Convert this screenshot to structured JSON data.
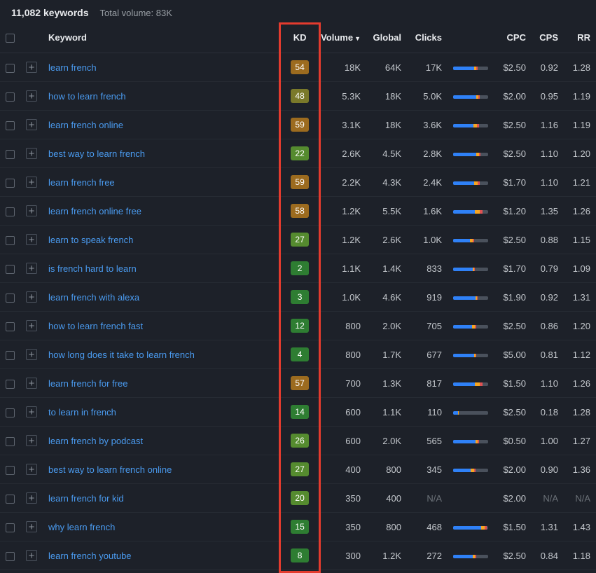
{
  "summary": {
    "keywords_count": "11,082 keywords",
    "total_volume": "Total volume: 83K"
  },
  "headers": {
    "keyword": "Keyword",
    "kd": "KD",
    "volume": "Volume",
    "global": "Global",
    "clicks": "Clicks",
    "cpc": "CPC",
    "cps": "CPS",
    "rr": "RR"
  },
  "rows": [
    {
      "keyword": "learn french",
      "kd": 54,
      "kd_cls": "amber",
      "volume": "18K",
      "global": "64K",
      "clicks": "17K",
      "bar": {
        "blue": 60,
        "orange": 6,
        "red": 4
      },
      "cpc": "$2.50",
      "cps": "0.92",
      "rr": "1.28"
    },
    {
      "keyword": "how to learn french",
      "kd": 48,
      "kd_cls": "olive",
      "volume": "5.3K",
      "global": "18K",
      "clicks": "5.0K",
      "bar": {
        "blue": 66,
        "orange": 6,
        "red": 4
      },
      "cpc": "$2.00",
      "cps": "0.95",
      "rr": "1.19"
    },
    {
      "keyword": "learn french online",
      "kd": 59,
      "kd_cls": "amber",
      "volume": "3.1K",
      "global": "18K",
      "clicks": "3.6K",
      "bar": {
        "blue": 58,
        "orange": 10,
        "red": 6
      },
      "cpc": "$2.50",
      "cps": "1.16",
      "rr": "1.19"
    },
    {
      "keyword": "best way to learn french",
      "kd": 22,
      "kd_cls": "lime",
      "volume": "2.6K",
      "global": "4.5K",
      "clicks": "2.8K",
      "bar": {
        "blue": 66,
        "orange": 8,
        "red": 4
      },
      "cpc": "$2.50",
      "cps": "1.10",
      "rr": "1.20"
    },
    {
      "keyword": "learn french free",
      "kd": 59,
      "kd_cls": "amber",
      "volume": "2.2K",
      "global": "4.3K",
      "clicks": "2.4K",
      "bar": {
        "blue": 60,
        "orange": 10,
        "red": 6
      },
      "cpc": "$1.70",
      "cps": "1.10",
      "rr": "1.21"
    },
    {
      "keyword": "learn french online free",
      "kd": 58,
      "kd_cls": "amber",
      "volume": "1.2K",
      "global": "5.5K",
      "clicks": "1.6K",
      "bar": {
        "blue": 62,
        "orange": 14,
        "red": 8
      },
      "cpc": "$1.20",
      "cps": "1.35",
      "rr": "1.26"
    },
    {
      "keyword": "learn to speak french",
      "kd": 27,
      "kd_cls": "lime",
      "volume": "1.2K",
      "global": "2.6K",
      "clicks": "1.0K",
      "bar": {
        "blue": 48,
        "orange": 8,
        "red": 4
      },
      "cpc": "$2.50",
      "cps": "0.88",
      "rr": "1.15"
    },
    {
      "keyword": "is french hard to learn",
      "kd": 2,
      "kd_cls": "green",
      "volume": "1.1K",
      "global": "1.4K",
      "clicks": "833",
      "bar": {
        "blue": 56,
        "orange": 4,
        "red": 2
      },
      "cpc": "$1.70",
      "cps": "0.79",
      "rr": "1.09"
    },
    {
      "keyword": "learn french with alexa",
      "kd": 3,
      "kd_cls": "green",
      "volume": "1.0K",
      "global": "4.6K",
      "clicks": "919",
      "bar": {
        "blue": 64,
        "orange": 4,
        "red": 2
      },
      "cpc": "$1.90",
      "cps": "0.92",
      "rr": "1.31"
    },
    {
      "keyword": "how to learn french fast",
      "kd": 12,
      "kd_cls": "green",
      "volume": "800",
      "global": "2.0K",
      "clicks": "705",
      "bar": {
        "blue": 54,
        "orange": 8,
        "red": 4
      },
      "cpc": "$2.50",
      "cps": "0.86",
      "rr": "1.20"
    },
    {
      "keyword": "how long does it take to learn french",
      "kd": 4,
      "kd_cls": "green",
      "volume": "800",
      "global": "1.7K",
      "clicks": "677",
      "bar": {
        "blue": 60,
        "orange": 4,
        "red": 2
      },
      "cpc": "$5.00",
      "cps": "0.81",
      "rr": "1.12"
    },
    {
      "keyword": "learn french for free",
      "kd": 57,
      "kd_cls": "amber",
      "volume": "700",
      "global": "1.3K",
      "clicks": "817",
      "bar": {
        "blue": 62,
        "orange": 14,
        "red": 8
      },
      "cpc": "$1.50",
      "cps": "1.10",
      "rr": "1.26"
    },
    {
      "keyword": "to learn in french",
      "kd": 14,
      "kd_cls": "green",
      "volume": "600",
      "global": "1.1K",
      "clicks": "110",
      "bar": {
        "blue": 14,
        "orange": 2,
        "red": 0
      },
      "cpc": "$2.50",
      "cps": "0.18",
      "rr": "1.28"
    },
    {
      "keyword": "learn french by podcast",
      "kd": 26,
      "kd_cls": "lime",
      "volume": "600",
      "global": "2.0K",
      "clicks": "565",
      "bar": {
        "blue": 64,
        "orange": 6,
        "red": 4
      },
      "cpc": "$0.50",
      "cps": "1.00",
      "rr": "1.27"
    },
    {
      "keyword": "best way to learn french online",
      "kd": 27,
      "kd_cls": "lime",
      "volume": "400",
      "global": "800",
      "clicks": "345",
      "bar": {
        "blue": 50,
        "orange": 10,
        "red": 4
      },
      "cpc": "$2.00",
      "cps": "0.90",
      "rr": "1.36"
    },
    {
      "keyword": "learn french for kid",
      "kd": 20,
      "kd_cls": "lime",
      "volume": "350",
      "global": "400",
      "clicks": "N/A",
      "bar": null,
      "cpc": "$2.00",
      "cps": "N/A",
      "rr": "N/A"
    },
    {
      "keyword": "why learn french",
      "kd": 15,
      "kd_cls": "green",
      "volume": "350",
      "global": "800",
      "clicks": "468",
      "bar": {
        "blue": 80,
        "orange": 10,
        "red": 6
      },
      "cpc": "$1.50",
      "cps": "1.31",
      "rr": "1.43"
    },
    {
      "keyword": "learn french youtube",
      "kd": 8,
      "kd_cls": "green",
      "volume": "300",
      "global": "1.2K",
      "clicks": "272",
      "bar": {
        "blue": 56,
        "orange": 6,
        "red": 4
      },
      "cpc": "$2.50",
      "cps": "0.84",
      "rr": "1.18"
    }
  ]
}
